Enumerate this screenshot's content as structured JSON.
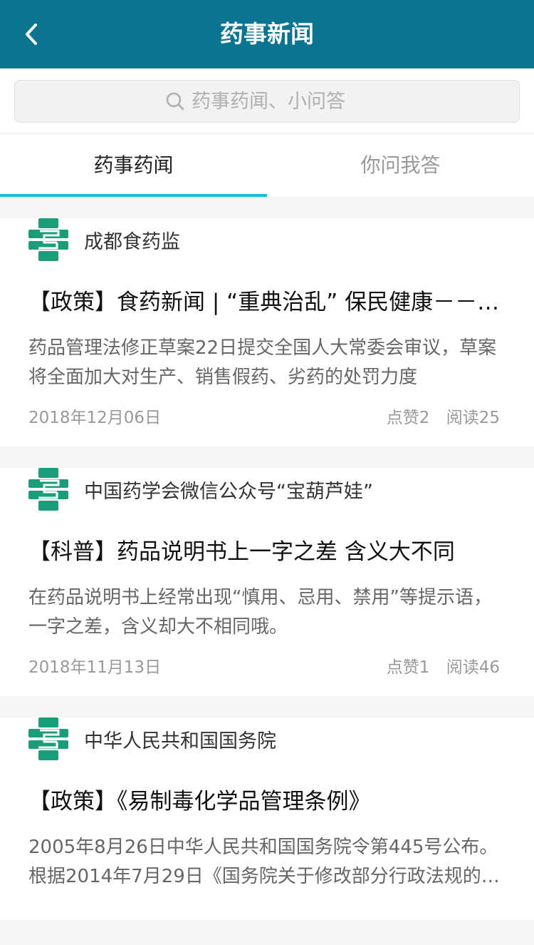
{
  "header": {
    "title": "药事新闻"
  },
  "search": {
    "placeholder": "药事药闻、小问答"
  },
  "tabs": [
    {
      "label": "药事药闻",
      "active": true
    },
    {
      "label": "你问我答",
      "active": false
    }
  ],
  "colors": {
    "navbar": "#0a7491",
    "tab_indicator": "#1fb8e0",
    "logo_green": "#1a9e7a"
  },
  "articles": [
    {
      "source": "成都食药监",
      "title": "【政策】食药新闻 | “重典治乱” 保民健康－－药品管理法修正草案",
      "summary": "药品管理法修正草案22日提交全国人大常委会审议，草案将全面加大对生产、销售假药、劣药的处罚力度",
      "date": "2018年12月06日",
      "likes": "点赞2",
      "reads": "阅读25"
    },
    {
      "source": "中国药学会微信公众号“宝葫芦娃”",
      "title": "【科普】药品说明书上一字之差 含义大不同",
      "summary": "在药品说明书上经常出现“慎用、忌用、禁用”等提示语，一字之差，含义却大不相同哦。",
      "date": "2018年11月13日",
      "likes": "点赞1",
      "reads": "阅读46"
    },
    {
      "source": "中华人民共和国国务院",
      "title": "【政策】《易制毒化学品管理条例》",
      "summary": "2005年8月26日中华人民共和国国务院令第445号公布。根据2014年7月29日《国务院关于修改部分行政法规的决定》修订"
    }
  ]
}
